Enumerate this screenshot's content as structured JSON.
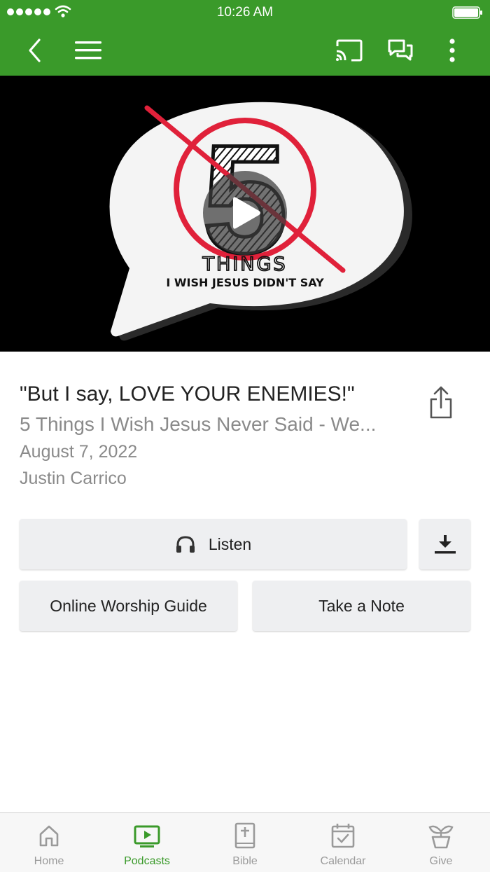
{
  "status_bar": {
    "time": "10:26 AM"
  },
  "colors": {
    "brand": "#3a9a2a",
    "hero_bg": "#000000",
    "muted_text": "#8a8a8a",
    "button_bg": "#eeeff1"
  },
  "hero": {
    "artwork_text_line1": "THINGS",
    "artwork_text_line2": "I WISH JESUS DIDN'T SAY",
    "artwork_numeral": "5"
  },
  "sermon": {
    "title": "\"But I say, LOVE YOUR ENEMIES!\"",
    "series": "5 Things I Wish Jesus Never Said - We...",
    "date": "August 7, 2022",
    "speaker": "Justin Carrico"
  },
  "actions": {
    "listen_label": "Listen",
    "worship_guide_label": "Online Worship Guide",
    "note_label": "Take a Note"
  },
  "tabs": [
    {
      "label": "Home",
      "icon": "home-icon"
    },
    {
      "label": "Podcasts",
      "icon": "tv-play-icon",
      "active": true
    },
    {
      "label": "Bible",
      "icon": "bible-icon"
    },
    {
      "label": "Calendar",
      "icon": "calendar-check-icon"
    },
    {
      "label": "Give",
      "icon": "plant-icon"
    }
  ]
}
